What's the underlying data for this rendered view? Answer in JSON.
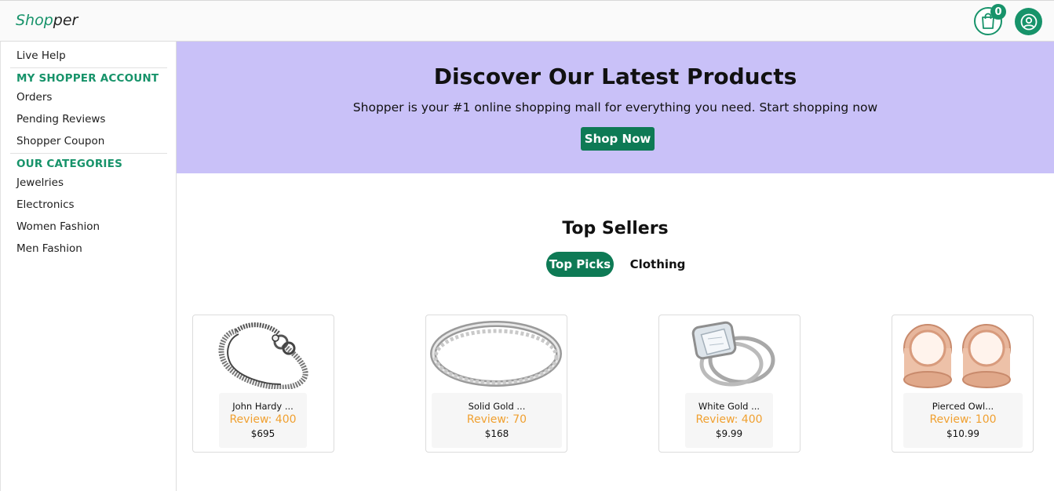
{
  "header": {
    "logo_part1": "Shop",
    "logo_part2": "per",
    "cart_count": "0",
    "cart_icon": "shopping-bag-icon",
    "user_icon": "user-circle-icon",
    "accent_color": "#17936a"
  },
  "sidebar": {
    "live_help": "Live Help",
    "account_heading": "MY SHOPPER ACCOUNT",
    "account_items": [
      "Orders",
      "Pending Reviews",
      "Shopper Coupon"
    ],
    "categories_heading": "OUR CATEGORIES",
    "category_items": [
      "Jewelries",
      "Electronics",
      "Women Fashion",
      "Men Fashion"
    ]
  },
  "hero": {
    "title": "Discover Our Latest Products",
    "subtitle": "Shopper is your #1 online shopping mall for everything you need. Start shopping now",
    "button": "Shop Now",
    "background": "#c9c1f8"
  },
  "top_sellers": {
    "title": "Top Sellers",
    "tabs": [
      "Top Picks",
      "Clothing"
    ],
    "active_tab": "Top Picks"
  },
  "products": [
    {
      "name": "John Hardy ...",
      "review": "Review: 400",
      "price": "$695",
      "image": "silver-chain-bracelet"
    },
    {
      "name": "Solid Gold ...",
      "review": "Review: 70",
      "price": "$168",
      "image": "diamond-eternity-band"
    },
    {
      "name": "White Gold ...",
      "review": "Review: 400",
      "price": "$9.99",
      "image": "engagement-ring-set"
    },
    {
      "name": "Pierced Owl...",
      "review": "Review: 100",
      "price": "$10.99",
      "image": "rose-gold-tunnel-plugs"
    }
  ]
}
